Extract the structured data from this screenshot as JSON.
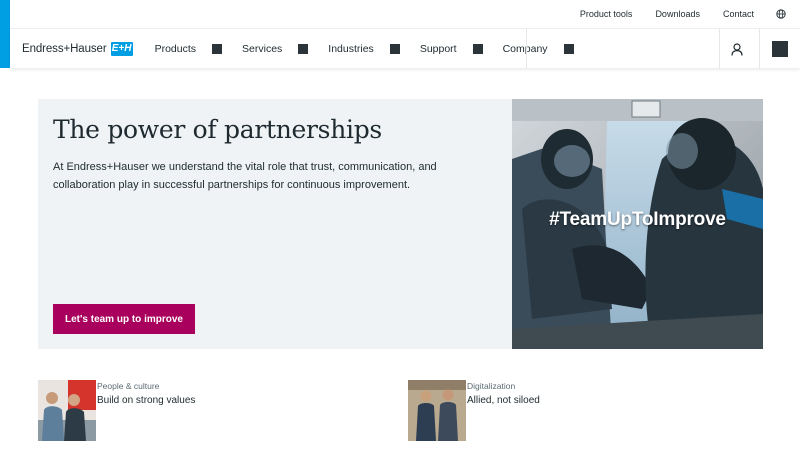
{
  "utility": {
    "links": [
      "Product tools",
      "Downloads",
      "Contact"
    ]
  },
  "header": {
    "brand": "Endress+Hauser",
    "brand_mark": "E+H",
    "nav": [
      "Products",
      "Services",
      "Industries",
      "Support",
      "Company"
    ]
  },
  "hero": {
    "title": "The power of partnerships",
    "description": "At Endress+Hauser we understand the vital role that trust, communication, and collaboration play in successful partnerships for continuous improvement.",
    "cta_label": "Let's team up to improve",
    "image_hashtag": "#TeamUpToImprove"
  },
  "cards": [
    {
      "tag": "People & culture",
      "title": "Build on strong values"
    },
    {
      "tag": "Digitalization",
      "title": "Allied, not siloed"
    }
  ],
  "colors": {
    "accent_blue": "#009ee3",
    "cta_magenta": "#a8005c",
    "hero_bg": "#eff3f5",
    "dark_square": "#2b3539"
  },
  "icons": [
    "globe-icon",
    "user-icon",
    "menu-icon",
    "nav-dropdown-icon"
  ]
}
